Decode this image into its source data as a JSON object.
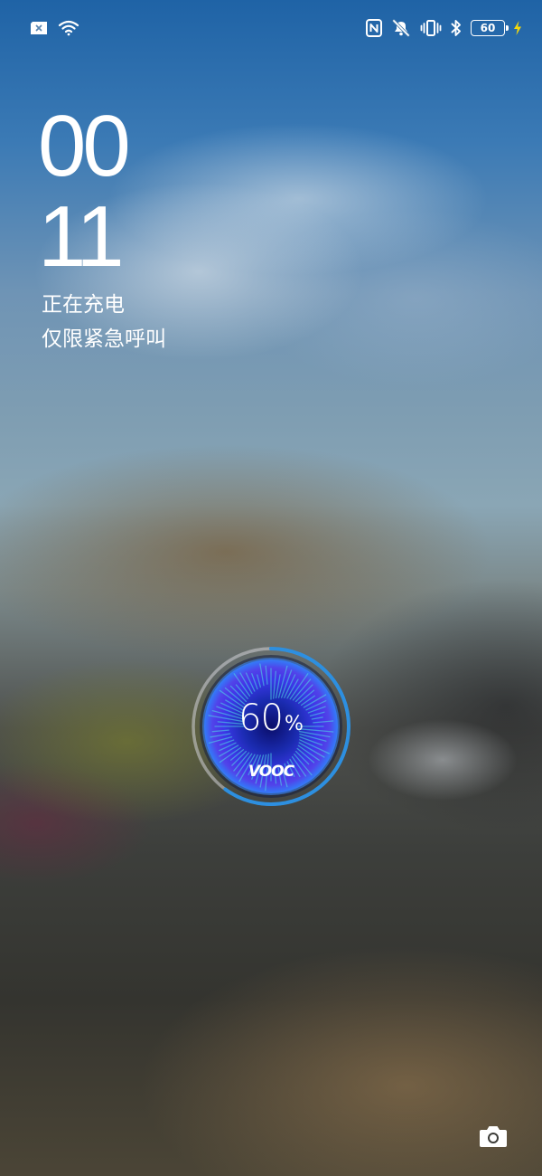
{
  "status_bar": {
    "left_icons": [
      "sim-error-icon",
      "wifi-icon"
    ],
    "right_icons": [
      "nfc-icon",
      "mute-icon",
      "vibrate-icon",
      "bluetooth-icon"
    ],
    "battery_level": "60",
    "charging_bolt_color": "#f5d90a"
  },
  "lock_screen": {
    "hours": "00",
    "minutes": "11",
    "charging_status": "正在充电",
    "emergency_text": "仅限紧急呼叫"
  },
  "charging_widget": {
    "percent": "60",
    "percent_sign": "%",
    "brand": "VOOC",
    "progress": 0.6,
    "ring_color": "#2d8fe0",
    "glow_color": "#3b38e8"
  },
  "shortcuts": {
    "camera_icon": "camera-icon"
  }
}
